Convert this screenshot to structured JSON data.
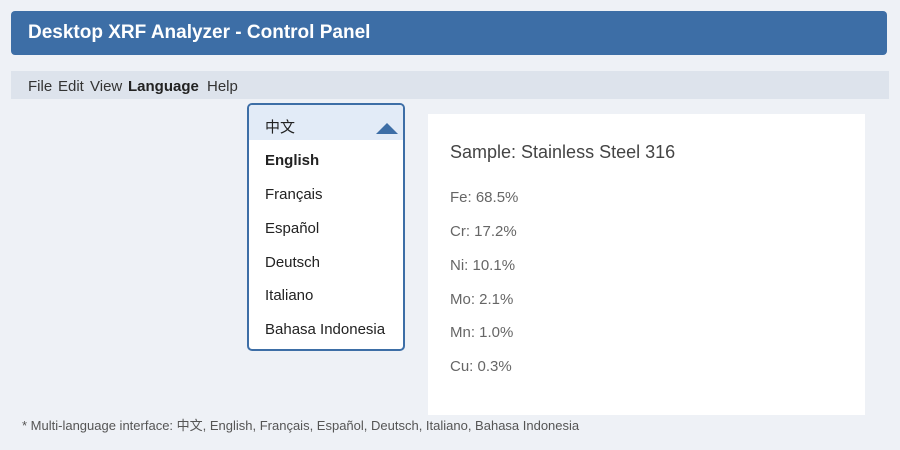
{
  "window": {
    "title": "Desktop XRF Analyzer - Control Panel"
  },
  "menu": {
    "items": [
      "File",
      "Edit",
      "View",
      "Language",
      "Help"
    ],
    "active": "Language"
  },
  "language_dropdown": {
    "selected_display": "中文",
    "options": [
      "English",
      "Français",
      "Español",
      "Deutsch",
      "Italiano",
      "Bahasa Indonesia"
    ],
    "highlighted_option": "English",
    "state": "expanded"
  },
  "sample": {
    "title": "Sample: Stainless Steel 316",
    "elements": [
      "Fe: 68.5%",
      "Cr: 17.2%",
      "Ni: 10.1%",
      "Mo: 2.1%",
      "Mn: 1.0%",
      "Cu: 0.3%"
    ]
  },
  "footnote": "* Multi-language interface: 中文, English, Français, Español, Deutsch, Italiano, Bahasa Indonesia",
  "colors": {
    "accent": "#3d6ea6",
    "background": "#eef1f6",
    "menu_bar": "#dde3ec",
    "selected_row": "#e2ebf7"
  },
  "icons": {
    "dropdown_caret": "caret-up-icon"
  }
}
